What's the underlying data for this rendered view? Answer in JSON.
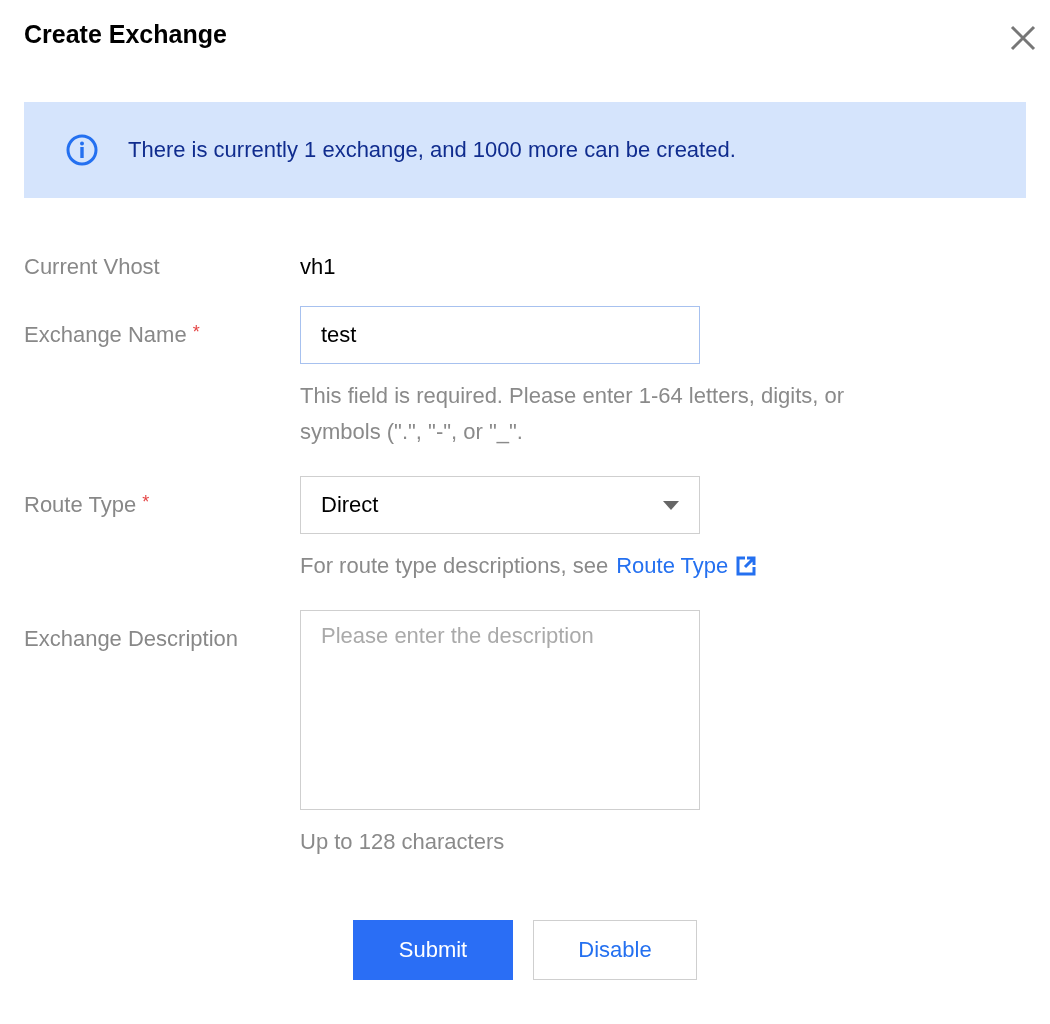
{
  "dialog": {
    "title": "Create Exchange"
  },
  "notice": {
    "text": "There is currently 1 exchange, and 1000 more can be created."
  },
  "form": {
    "rows": [
      {
        "kind": "text",
        "label": "Current Vhost",
        "value": "vh1"
      },
      {
        "kind": "input",
        "label": "Exchange Name",
        "required_mark": "*",
        "value": "test",
        "help": "This field is required. Please enter 1-64 letters, digits, or symbols (\".\", \"-\", or \"_\"."
      },
      {
        "kind": "select",
        "label": "Route Type",
        "required_mark": "*",
        "value": "Direct",
        "help": "For route type descriptions, see",
        "help_link": "Route Type"
      },
      {
        "kind": "textarea",
        "label": "Exchange Description",
        "placeholder": "Please enter the description",
        "help": "Up to 128 characters"
      }
    ]
  },
  "buttons": [
    {
      "label": "Submit",
      "kind": "primary"
    },
    {
      "label": "Disable",
      "kind": "secondary"
    }
  ]
}
